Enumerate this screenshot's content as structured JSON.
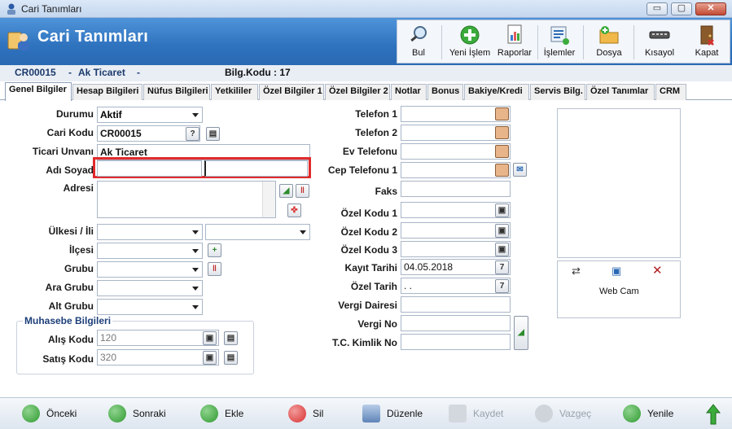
{
  "window": {
    "title": "Cari Tanımları",
    "buttons": {
      "minimize": "▭",
      "maximize": "▢",
      "close": "✕"
    }
  },
  "header": {
    "title": "Cari Tanımları"
  },
  "toolbar": {
    "bul": "Bul",
    "yeni_islem": "Yeni İşlem",
    "raporlar": "Raporlar",
    "islemler": "İşlemler",
    "dosya": "Dosya",
    "kisayol": "Kısayol",
    "kapat": "Kapat"
  },
  "info": {
    "code": "CR00015",
    "sep1": "-",
    "name": "Ak Ticaret",
    "sep2": "-",
    "bilg_kodu": "Bilg.Kodu : 17"
  },
  "tabs": [
    "Genel Bilgiler",
    "Hesap Bilgileri",
    "Nüfus Bilgileri",
    "Yetkililer",
    "Özel Bilgiler 1",
    "Özel Bilgiler 2",
    "Notlar",
    "Bonus",
    "Bakiye/Kredi",
    "Servis Bilg.",
    "Özel Tanımlar",
    "CRM"
  ],
  "form": {
    "durumu_label": "Durumu",
    "durumu_value": "Aktif",
    "cari_kodu_label": "Cari Kodu",
    "cari_kodu_value": "CR00015",
    "ticari_unvani_label": "Ticari Unvanı",
    "ticari_unvani_value": "Ak Ticaret",
    "adi_soyad_label": "Adı Soyad",
    "adi_value": "",
    "soyad_value": "",
    "adresi_label": "Adresi",
    "adresi_value": "",
    "ulkesi_label": "Ülkesi / İli",
    "ulke_value": "",
    "il_value": "",
    "ilcesi_label": "İlçesi",
    "ilce_value": "",
    "grubu_label": "Grubu",
    "grubu_value": "",
    "ara_grubu_label": "Ara Grubu",
    "ara_grubu_value": "",
    "alt_grubu_label": "Alt Grubu",
    "alt_grubu_value": "",
    "muhasebe_legend": "Muhasebe Bilgileri",
    "alis_kodu_label": "Alış Kodu",
    "alis_kodu_value": "120",
    "satis_kodu_label": "Satış Kodu",
    "satis_kodu_value": "320",
    "telefon1_label": "Telefon 1",
    "telefon1_value": "",
    "telefon2_label": "Telefon 2",
    "telefon2_value": "",
    "ev_telefonu_label": "Ev Telefonu",
    "ev_telefonu_value": "",
    "cep_telefonu_label": "Cep Telefonu 1",
    "cep_telefonu_value": "",
    "faks_label": "Faks",
    "faks_value": "",
    "ozel_kodu1_label": "Özel Kodu 1",
    "ozel_kodu1_value": "",
    "ozel_kodu2_label": "Özel Kodu 2",
    "ozel_kodu2_value": "",
    "ozel_kodu3_label": "Özel Kodu 3",
    "ozel_kodu3_value": "",
    "kayit_tarihi_label": "Kayıt Tarihi",
    "kayit_tarihi_value": "04.05.2018",
    "ozel_tarih_label": "Özel Tarih",
    "ozel_tarih_value": ". .",
    "vergi_dairesi_label": "Vergi Dairesi",
    "vergi_dairesi_value": "",
    "vergi_no_label": "Vergi No",
    "vergi_no_value": "",
    "tc_kimlik_label": "T.C. Kimlik No",
    "tc_kimlik_value": "",
    "webcam_label": "Web Cam",
    "help_button": "?"
  },
  "bottom": {
    "onceki": "Önceki",
    "sonraki": "Sonraki",
    "ekle": "Ekle",
    "sil": "Sil",
    "duzenle": "Düzenle",
    "kaydet": "Kaydet",
    "vazgec": "Vazgeç",
    "yenile": "Yenile"
  },
  "colors": {
    "header_blue": "#2e72be",
    "highlight_red": "#e02b2b",
    "green_button": "#3bab3b",
    "red_button": "#d9302f"
  }
}
